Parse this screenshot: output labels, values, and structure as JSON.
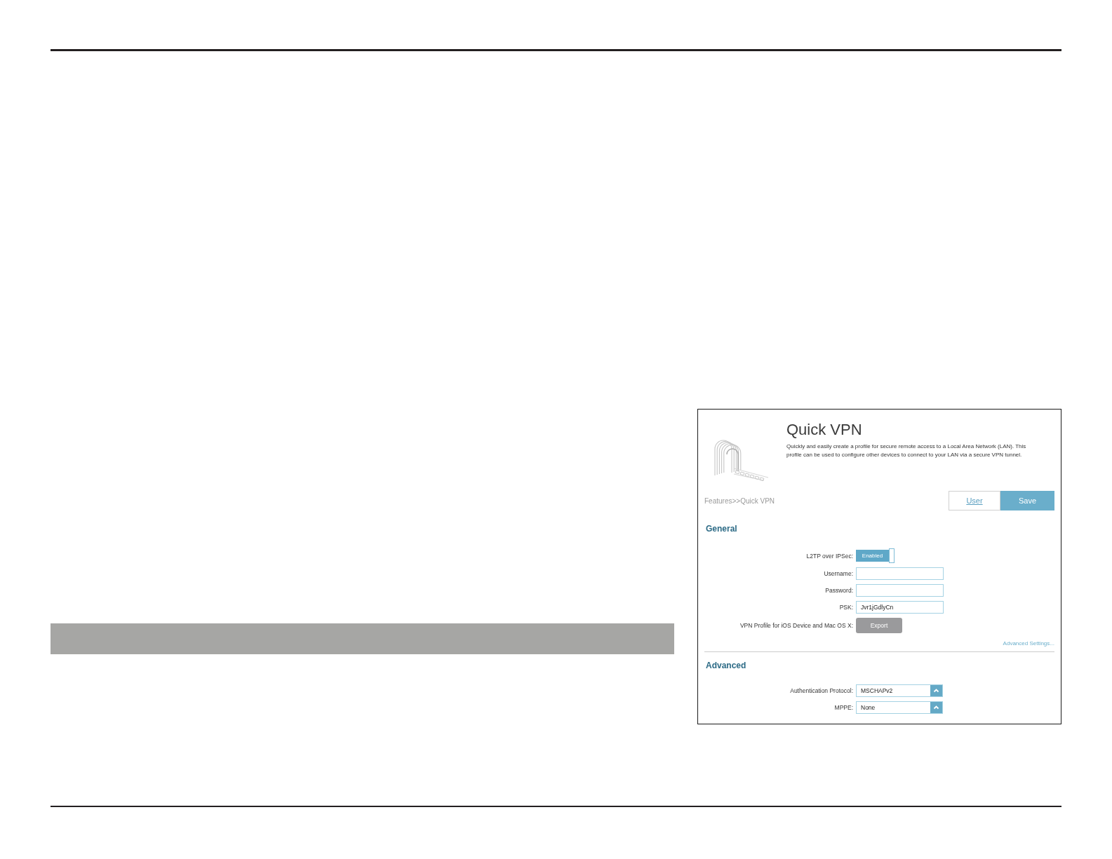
{
  "screenshot": {
    "title": "Quick VPN",
    "description": "Quickly and easily create a profile for secure remote access to a Local Area Network (LAN). This profile can be used to configure other devices to connect to your LAN via a secure VPN tunnel.",
    "breadcrumb": "Features>>Quick VPN",
    "buttons": [
      {
        "label": "User",
        "kind": "link"
      },
      {
        "label": "Save",
        "kind": "primary"
      }
    ],
    "sections": [
      {
        "title": "General",
        "fields": [
          {
            "kind": "toggle",
            "label": "L2TP over IPSec:",
            "value": "Enabled",
            "on": true
          },
          {
            "kind": "text",
            "label": "Username:"
          },
          {
            "kind": "text",
            "label": "Password:"
          },
          {
            "kind": "text",
            "label": "PSK:",
            "value": "Jvr1jGdlyCn"
          },
          {
            "kind": "button",
            "label": "VPN Profile for iOS Device and Mac OS X:",
            "button": "Export"
          }
        ],
        "link": "Advanced Settings..."
      },
      {
        "title": "Advanced",
        "fields": [
          {
            "kind": "select",
            "label": "Authentication Protocol:",
            "value": "MSCHAPv2"
          },
          {
            "kind": "select",
            "label": "MPPE:",
            "value": "None"
          }
        ]
      }
    ]
  }
}
